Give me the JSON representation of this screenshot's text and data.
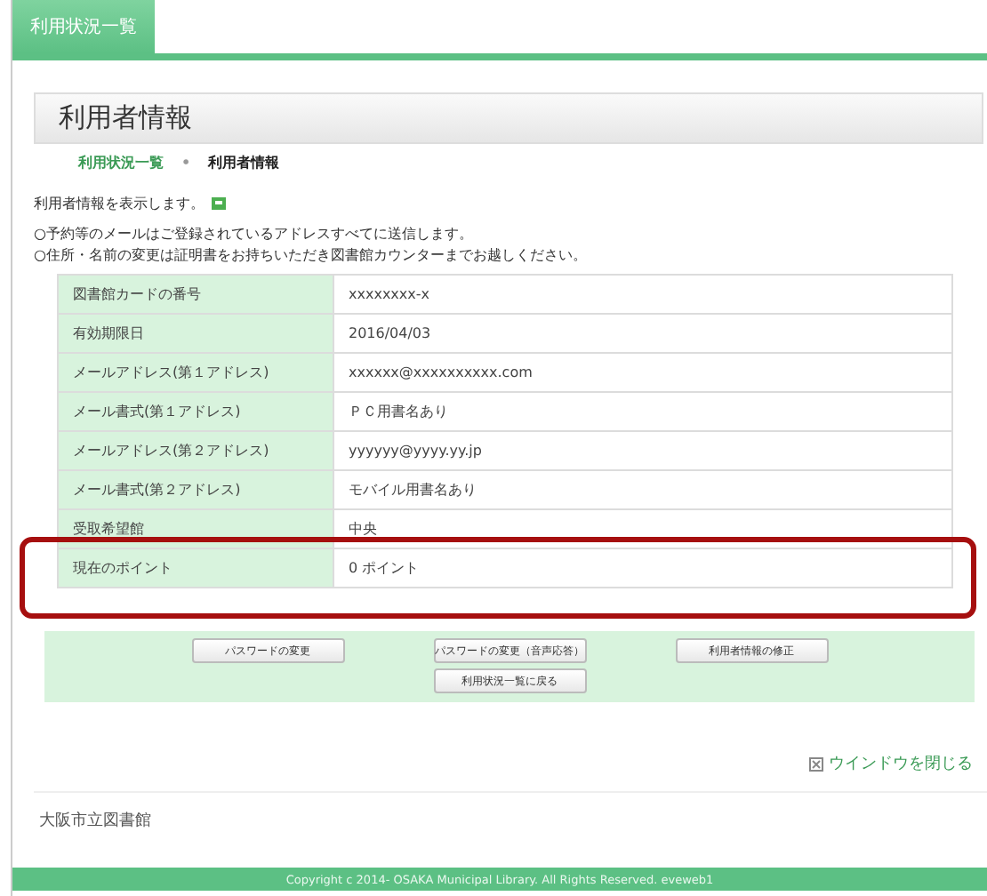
{
  "tab": {
    "label": "利用状況一覧",
    "selected": true
  },
  "heading": "利用者情報",
  "breadcrumb_separator": "•",
  "breadcrumb": [
    {
      "label": "利用状況一覧",
      "kind": "link"
    },
    {
      "label": "利用者情報",
      "kind": "current"
    }
  ],
  "intro": "利用者情報を表示します。",
  "notes": [
    "○予約等のメールはご登録されているアドレスすべてに送信します。",
    "○住所・名前の変更は証明書をお持ちいただき図書館カウンターまでお越しください。"
  ],
  "rows": [
    {
      "label": "図書館カードの番号",
      "value": "xxxxxxxx-x",
      "highlighted": false
    },
    {
      "label": "有効期限日",
      "value": "2016/04/03",
      "highlighted": false
    },
    {
      "label": "メールアドレス(第１アドレス)",
      "value": "xxxxxx@xxxxxxxxxx.com",
      "highlighted": false
    },
    {
      "label": "メール書式(第１アドレス)",
      "value": "ＰＣ用書名あり",
      "highlighted": false
    },
    {
      "label": "メールアドレス(第２アドレス)",
      "value": "yyyyyy@yyyy.yy.jp",
      "highlighted": false
    },
    {
      "label": "メール書式(第２アドレス)",
      "value": "モバイル用書名あり",
      "highlighted": false
    },
    {
      "label": "受取希望館",
      "value": "中央",
      "highlighted": false
    },
    {
      "label": "現在のポイント",
      "value": "0 ポイント",
      "highlighted": true
    }
  ],
  "buttons": [
    [
      "パスワードの変更",
      "パスワードの変更（音声応答）",
      "利用者情報の修正"
    ],
    [
      "利用状況一覧に戻る"
    ]
  ],
  "close_link": "ウインドウを閉じる",
  "footer": {
    "name": "大阪市立図書館",
    "copyright": "Copyright c 2014- OSAKA Municipal Library. All Rights Reserved. eveweb1"
  }
}
